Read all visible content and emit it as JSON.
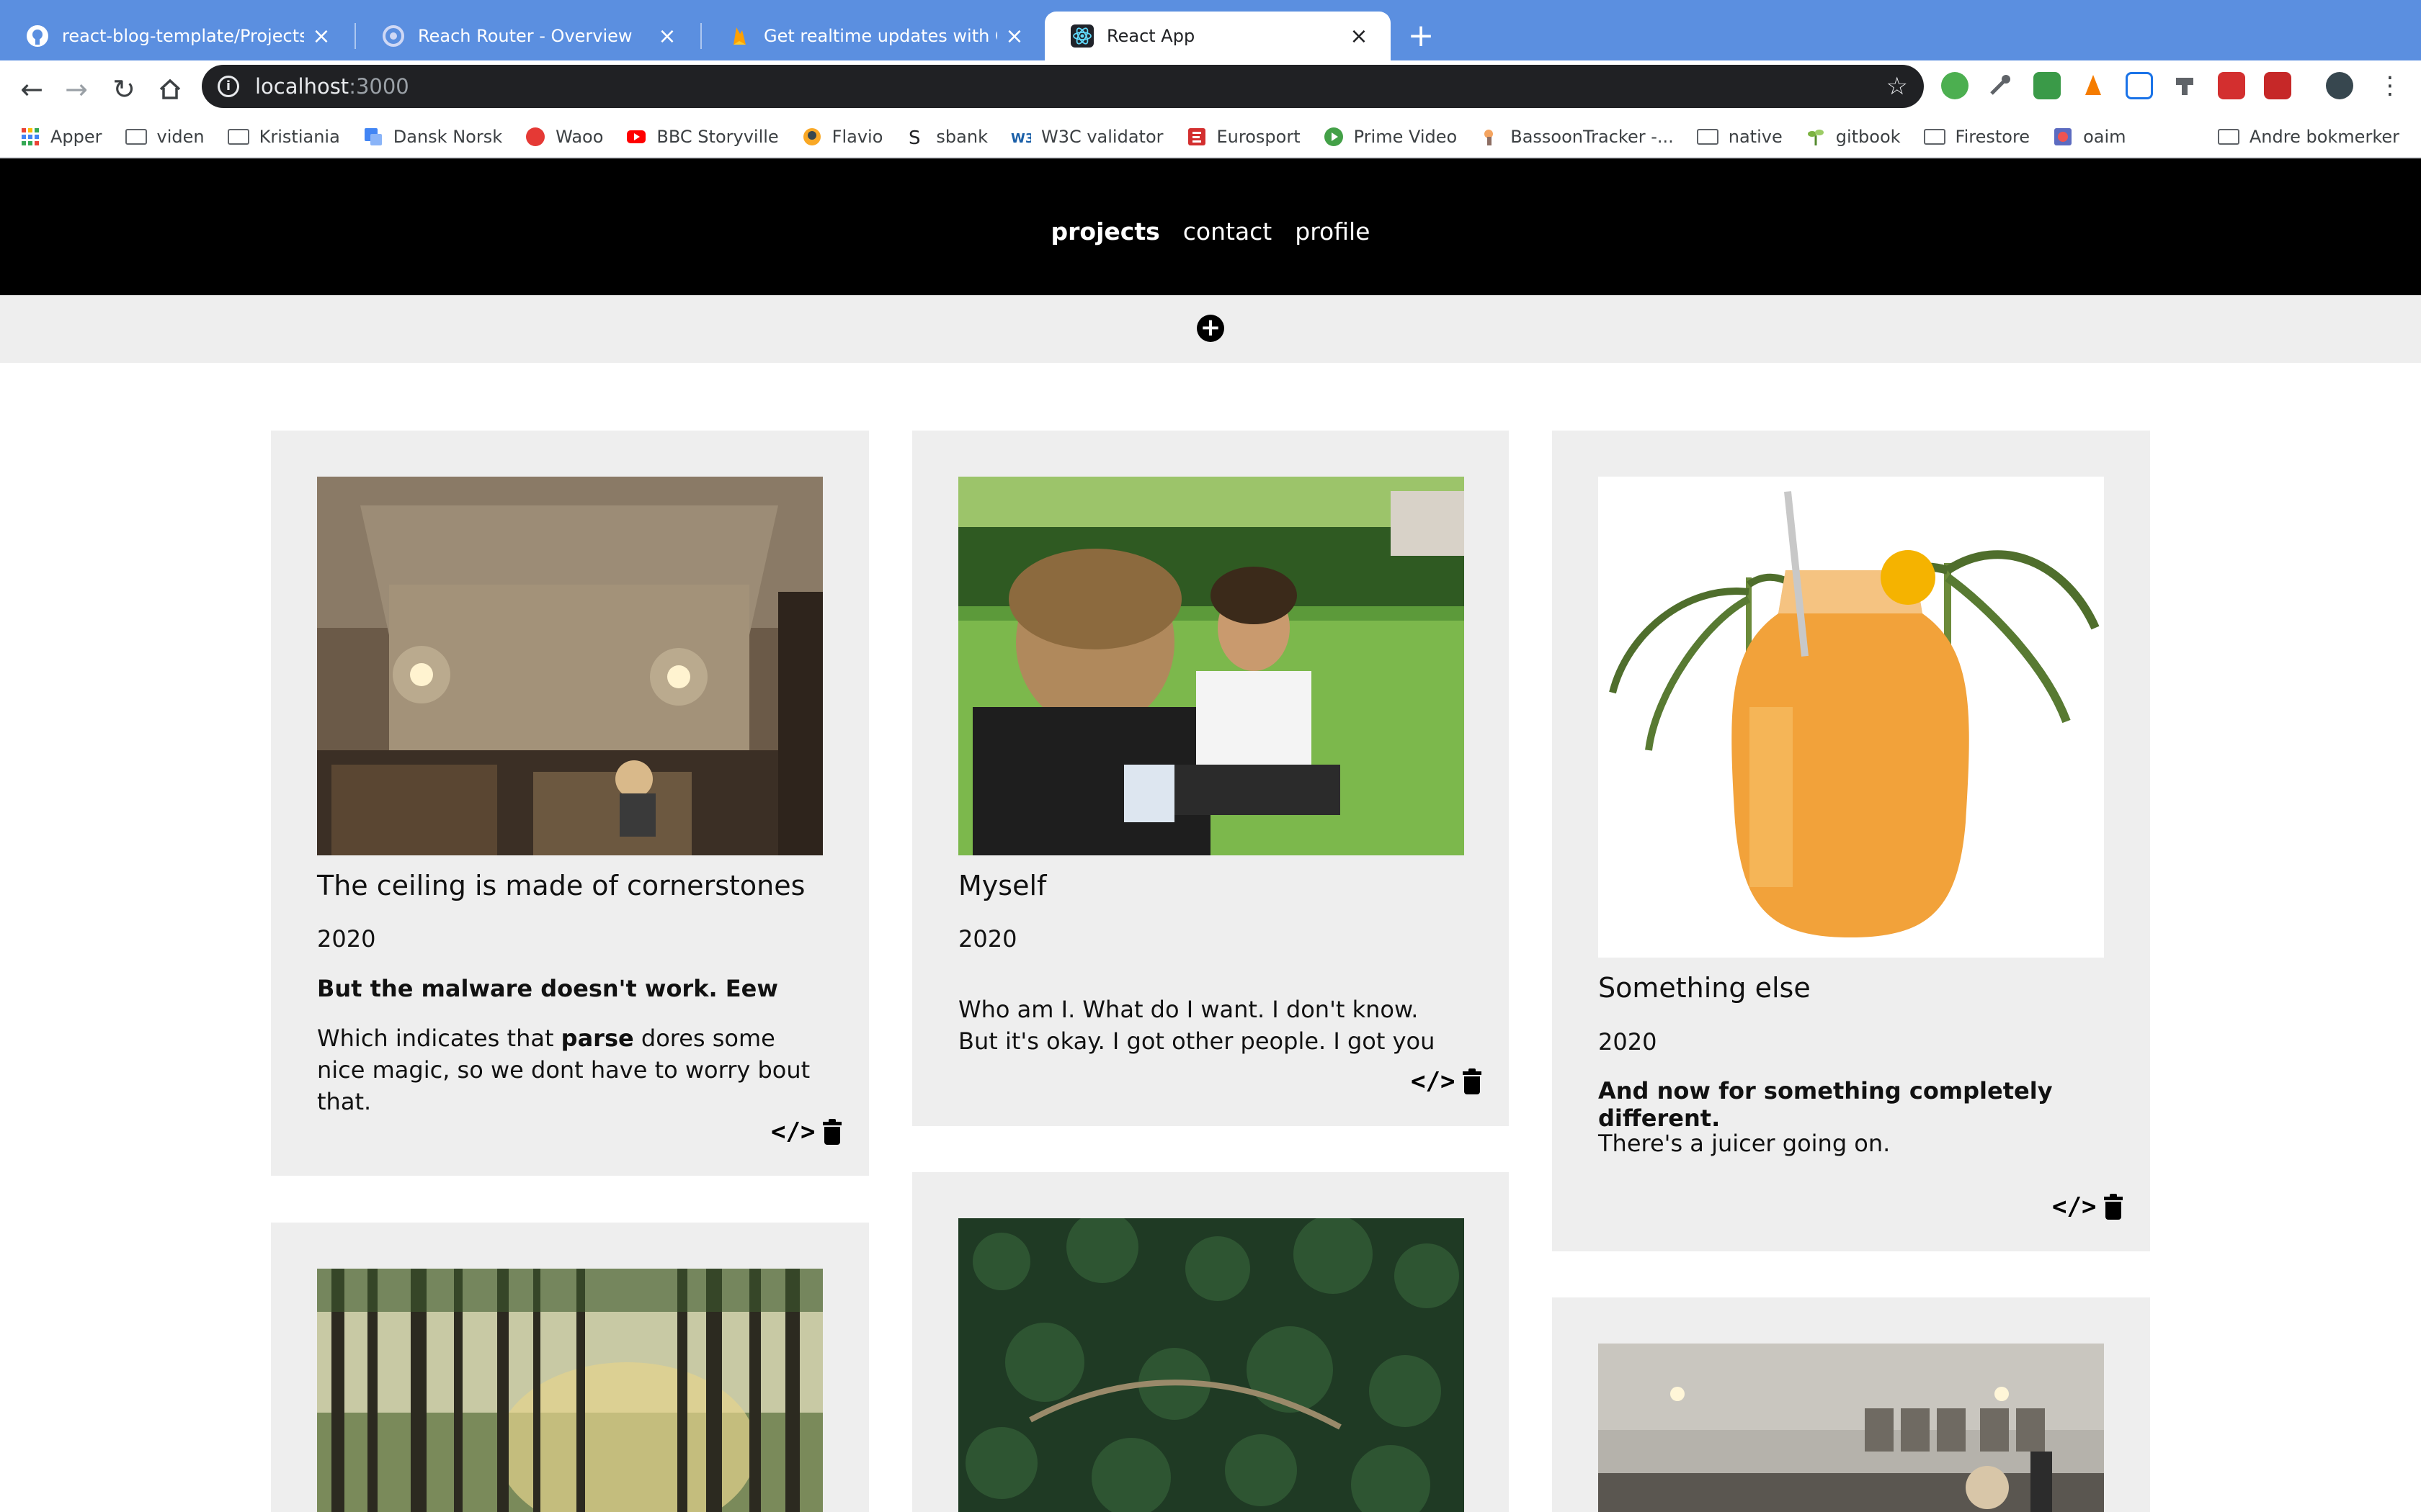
{
  "browser": {
    "tabs": [
      {
        "label": "react-blog-template/Projects.js",
        "icon": "github-icon",
        "active": false
      },
      {
        "label": "Reach Router - Overview",
        "icon": "reach-router-icon",
        "active": false
      },
      {
        "label": "Get realtime updates with Cloud",
        "icon": "firebase-icon",
        "active": false
      },
      {
        "label": "React App",
        "icon": "react-icon",
        "active": true
      }
    ],
    "url_host": "localhost",
    "url_port": ":3000",
    "bookmarks": [
      {
        "label": "Apper",
        "icon": "apps-grid-icon"
      },
      {
        "label": "viden",
        "icon": "folder-icon"
      },
      {
        "label": "Kristiania",
        "icon": "folder-icon"
      },
      {
        "label": "Dansk Norsk",
        "icon": "translate-icon"
      },
      {
        "label": "Waoo",
        "icon": "waoo-icon"
      },
      {
        "label": "BBC Storyville",
        "icon": "youtube-icon"
      },
      {
        "label": "Flavio",
        "icon": "flavio-icon"
      },
      {
        "label": "sbank",
        "icon": "sbank-icon"
      },
      {
        "label": "W3C validator",
        "icon": "w3c-icon"
      },
      {
        "label": "Eurosport",
        "icon": "eurosport-icon"
      },
      {
        "label": "Prime Video",
        "icon": "prime-video-icon"
      },
      {
        "label": "BassoonTracker -...",
        "icon": "bassoontracker-icon"
      },
      {
        "label": "native",
        "icon": "folder-icon"
      },
      {
        "label": "gitbook",
        "icon": "gitbook-icon"
      },
      {
        "label": "Firestore",
        "icon": "folder-icon"
      },
      {
        "label": "oaim",
        "icon": "oaim-icon"
      }
    ],
    "other_bookmarks": "Andre bokmerker"
  },
  "app": {
    "nav": [
      "projects",
      "contact",
      "profile"
    ],
    "active_nav": "projects",
    "add_button": "+"
  },
  "projects": [
    {
      "title": "The ceiling is made of cornerstones",
      "year": "2020",
      "subtitle": "But the malware doesn't work. Eew",
      "desc_before": "Which indicates that ",
      "desc_bold": "parse",
      "desc_after": " dores some nice magic, so we dont have to worry bout that."
    },
    {
      "title": "Myself",
      "year": "2020",
      "subtitle": "",
      "desc": "Who am I. What do I want. I don't know. But it's okay. I got other people. I got you"
    },
    {
      "title": "Something else",
      "year": "2020",
      "subtitle": "And now for something completely different.",
      "desc": "There's a juicer going on."
    }
  ],
  "colors": {
    "tabstrip": "#5b8fe0",
    "header": "#000000",
    "card_bg": "#eeeeee",
    "subbar": "#eeeeee"
  }
}
